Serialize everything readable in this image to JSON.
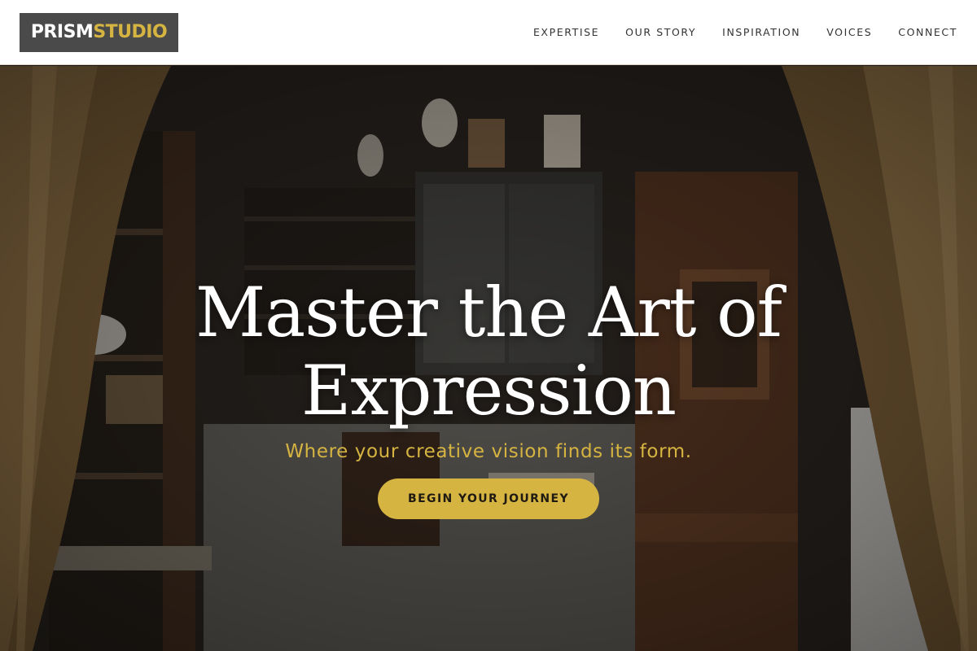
{
  "header": {
    "logo": {
      "part1": "PRISM",
      "part2": "STUDIO"
    },
    "nav": [
      {
        "label": "EXPERTISE"
      },
      {
        "label": "OUR STORY"
      },
      {
        "label": "INSPIRATION"
      },
      {
        "label": "VOICES"
      },
      {
        "label": "CONNECT"
      }
    ]
  },
  "hero": {
    "title_line1": "Master the Art of",
    "title_line2": "Expression",
    "subtitle": "Where your creative vision finds its form.",
    "cta_label": "BEGIN YOUR JOURNEY"
  },
  "colors": {
    "accent": "#d6b441",
    "logo_bg": "#4a4a4a",
    "header_bg": "#ffffff",
    "nav_text": "#333333"
  }
}
